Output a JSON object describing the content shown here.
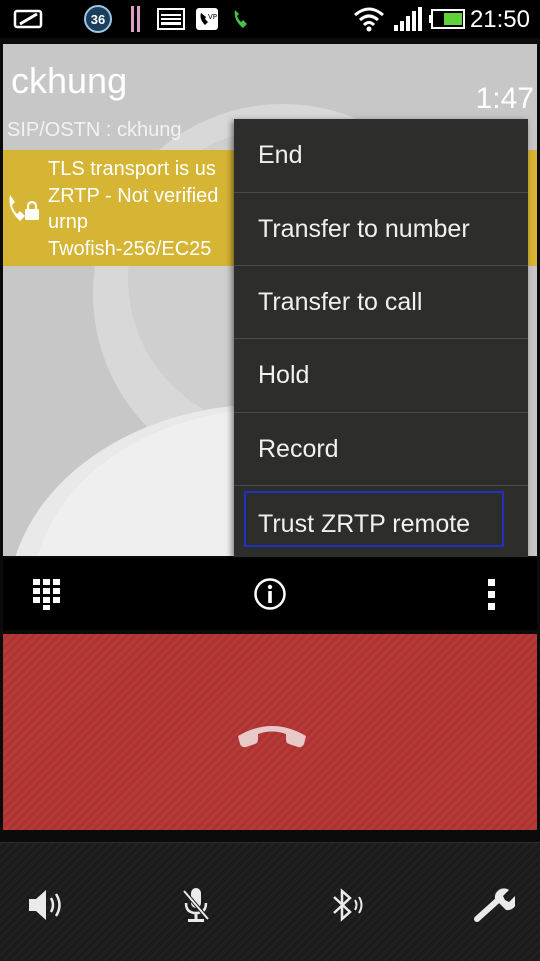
{
  "status_bar": {
    "clock": "21:50",
    "notification_count": "36",
    "icons": [
      "unlock-screen-icon",
      "notification-count-icon",
      "pause-bars-icon",
      "image-icon",
      "voicemail-icon",
      "phone-icon",
      "wifi-icon",
      "signal-icon",
      "battery-icon"
    ]
  },
  "call": {
    "remote_name": "ckhung",
    "duration": "1:47",
    "remote_uri": "SIP/OSTN : ckhung",
    "security": {
      "line1": "TLS transport is us",
      "line2": "ZRTP - Not verified",
      "line3": "urnp",
      "line4": "Twofish-256/EC25"
    }
  },
  "menu": {
    "items": [
      {
        "label": "End"
      },
      {
        "label": "Transfer to number"
      },
      {
        "label": "Transfer to call"
      },
      {
        "label": "Hold"
      },
      {
        "label": "Record"
      },
      {
        "label": "Trust ZRTP remote"
      }
    ]
  },
  "controls": {
    "icons": [
      "dialpad-icon",
      "info-icon",
      "overflow-menu-icon"
    ]
  },
  "end_call": {
    "icon": "hang-up-icon",
    "color": "#b83a38"
  },
  "bottom_bar": {
    "icons": [
      "speaker-icon",
      "mute-microphone-icon",
      "bluetooth-icon",
      "settings-wrench-icon"
    ]
  },
  "colors": {
    "security_bar": "#d6b534",
    "menu_background": "#2d2d2b",
    "focus_ring": "#2030c0"
  }
}
